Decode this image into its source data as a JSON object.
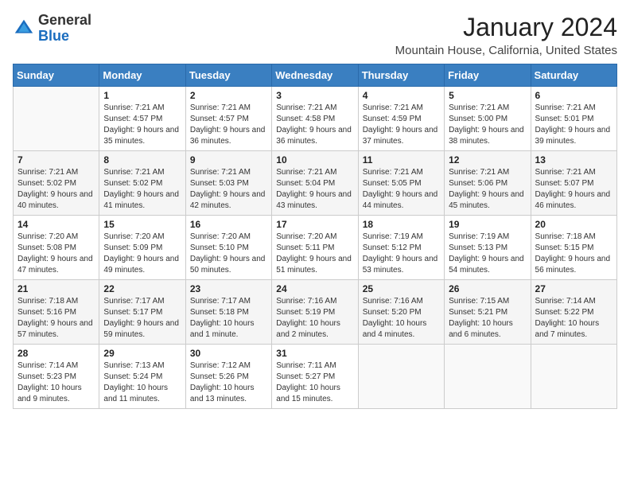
{
  "logo": {
    "general": "General",
    "blue": "Blue"
  },
  "header": {
    "month": "January 2024",
    "location": "Mountain House, California, United States"
  },
  "weekdays": [
    "Sunday",
    "Monday",
    "Tuesday",
    "Wednesday",
    "Thursday",
    "Friday",
    "Saturday"
  ],
  "weeks": [
    [
      {
        "day": "",
        "sunrise": "",
        "sunset": "",
        "daylight": ""
      },
      {
        "day": "1",
        "sunrise": "Sunrise: 7:21 AM",
        "sunset": "Sunset: 4:57 PM",
        "daylight": "Daylight: 9 hours and 35 minutes."
      },
      {
        "day": "2",
        "sunrise": "Sunrise: 7:21 AM",
        "sunset": "Sunset: 4:57 PM",
        "daylight": "Daylight: 9 hours and 36 minutes."
      },
      {
        "day": "3",
        "sunrise": "Sunrise: 7:21 AM",
        "sunset": "Sunset: 4:58 PM",
        "daylight": "Daylight: 9 hours and 36 minutes."
      },
      {
        "day": "4",
        "sunrise": "Sunrise: 7:21 AM",
        "sunset": "Sunset: 4:59 PM",
        "daylight": "Daylight: 9 hours and 37 minutes."
      },
      {
        "day": "5",
        "sunrise": "Sunrise: 7:21 AM",
        "sunset": "Sunset: 5:00 PM",
        "daylight": "Daylight: 9 hours and 38 minutes."
      },
      {
        "day": "6",
        "sunrise": "Sunrise: 7:21 AM",
        "sunset": "Sunset: 5:01 PM",
        "daylight": "Daylight: 9 hours and 39 minutes."
      }
    ],
    [
      {
        "day": "7",
        "sunrise": "Sunrise: 7:21 AM",
        "sunset": "Sunset: 5:02 PM",
        "daylight": "Daylight: 9 hours and 40 minutes."
      },
      {
        "day": "8",
        "sunrise": "Sunrise: 7:21 AM",
        "sunset": "Sunset: 5:02 PM",
        "daylight": "Daylight: 9 hours and 41 minutes."
      },
      {
        "day": "9",
        "sunrise": "Sunrise: 7:21 AM",
        "sunset": "Sunset: 5:03 PM",
        "daylight": "Daylight: 9 hours and 42 minutes."
      },
      {
        "day": "10",
        "sunrise": "Sunrise: 7:21 AM",
        "sunset": "Sunset: 5:04 PM",
        "daylight": "Daylight: 9 hours and 43 minutes."
      },
      {
        "day": "11",
        "sunrise": "Sunrise: 7:21 AM",
        "sunset": "Sunset: 5:05 PM",
        "daylight": "Daylight: 9 hours and 44 minutes."
      },
      {
        "day": "12",
        "sunrise": "Sunrise: 7:21 AM",
        "sunset": "Sunset: 5:06 PM",
        "daylight": "Daylight: 9 hours and 45 minutes."
      },
      {
        "day": "13",
        "sunrise": "Sunrise: 7:21 AM",
        "sunset": "Sunset: 5:07 PM",
        "daylight": "Daylight: 9 hours and 46 minutes."
      }
    ],
    [
      {
        "day": "14",
        "sunrise": "Sunrise: 7:20 AM",
        "sunset": "Sunset: 5:08 PM",
        "daylight": "Daylight: 9 hours and 47 minutes."
      },
      {
        "day": "15",
        "sunrise": "Sunrise: 7:20 AM",
        "sunset": "Sunset: 5:09 PM",
        "daylight": "Daylight: 9 hours and 49 minutes."
      },
      {
        "day": "16",
        "sunrise": "Sunrise: 7:20 AM",
        "sunset": "Sunset: 5:10 PM",
        "daylight": "Daylight: 9 hours and 50 minutes."
      },
      {
        "day": "17",
        "sunrise": "Sunrise: 7:20 AM",
        "sunset": "Sunset: 5:11 PM",
        "daylight": "Daylight: 9 hours and 51 minutes."
      },
      {
        "day": "18",
        "sunrise": "Sunrise: 7:19 AM",
        "sunset": "Sunset: 5:12 PM",
        "daylight": "Daylight: 9 hours and 53 minutes."
      },
      {
        "day": "19",
        "sunrise": "Sunrise: 7:19 AM",
        "sunset": "Sunset: 5:13 PM",
        "daylight": "Daylight: 9 hours and 54 minutes."
      },
      {
        "day": "20",
        "sunrise": "Sunrise: 7:18 AM",
        "sunset": "Sunset: 5:15 PM",
        "daylight": "Daylight: 9 hours and 56 minutes."
      }
    ],
    [
      {
        "day": "21",
        "sunrise": "Sunrise: 7:18 AM",
        "sunset": "Sunset: 5:16 PM",
        "daylight": "Daylight: 9 hours and 57 minutes."
      },
      {
        "day": "22",
        "sunrise": "Sunrise: 7:17 AM",
        "sunset": "Sunset: 5:17 PM",
        "daylight": "Daylight: 9 hours and 59 minutes."
      },
      {
        "day": "23",
        "sunrise": "Sunrise: 7:17 AM",
        "sunset": "Sunset: 5:18 PM",
        "daylight": "Daylight: 10 hours and 1 minute."
      },
      {
        "day": "24",
        "sunrise": "Sunrise: 7:16 AM",
        "sunset": "Sunset: 5:19 PM",
        "daylight": "Daylight: 10 hours and 2 minutes."
      },
      {
        "day": "25",
        "sunrise": "Sunrise: 7:16 AM",
        "sunset": "Sunset: 5:20 PM",
        "daylight": "Daylight: 10 hours and 4 minutes."
      },
      {
        "day": "26",
        "sunrise": "Sunrise: 7:15 AM",
        "sunset": "Sunset: 5:21 PM",
        "daylight": "Daylight: 10 hours and 6 minutes."
      },
      {
        "day": "27",
        "sunrise": "Sunrise: 7:14 AM",
        "sunset": "Sunset: 5:22 PM",
        "daylight": "Daylight: 10 hours and 7 minutes."
      }
    ],
    [
      {
        "day": "28",
        "sunrise": "Sunrise: 7:14 AM",
        "sunset": "Sunset: 5:23 PM",
        "daylight": "Daylight: 10 hours and 9 minutes."
      },
      {
        "day": "29",
        "sunrise": "Sunrise: 7:13 AM",
        "sunset": "Sunset: 5:24 PM",
        "daylight": "Daylight: 10 hours and 11 minutes."
      },
      {
        "day": "30",
        "sunrise": "Sunrise: 7:12 AM",
        "sunset": "Sunset: 5:26 PM",
        "daylight": "Daylight: 10 hours and 13 minutes."
      },
      {
        "day": "31",
        "sunrise": "Sunrise: 7:11 AM",
        "sunset": "Sunset: 5:27 PM",
        "daylight": "Daylight: 10 hours and 15 minutes."
      },
      {
        "day": "",
        "sunrise": "",
        "sunset": "",
        "daylight": ""
      },
      {
        "day": "",
        "sunrise": "",
        "sunset": "",
        "daylight": ""
      },
      {
        "day": "",
        "sunrise": "",
        "sunset": "",
        "daylight": ""
      }
    ]
  ]
}
